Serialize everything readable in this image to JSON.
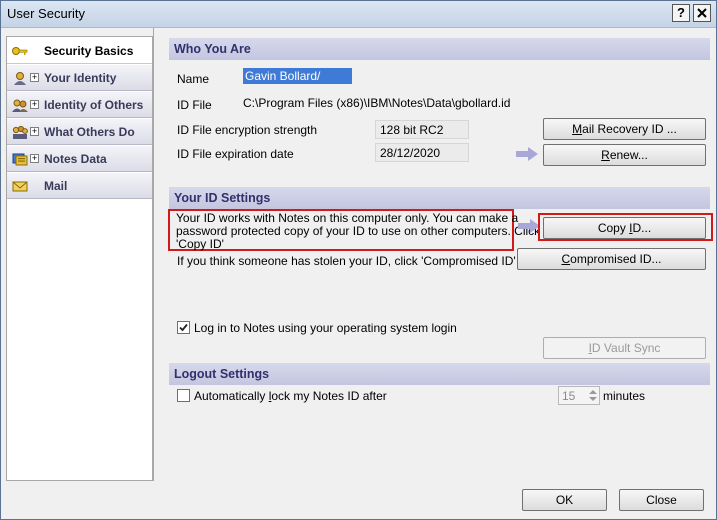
{
  "window": {
    "title": "User Security",
    "help_glyph": "?",
    "close_glyph": "X"
  },
  "sidebar": {
    "items": [
      {
        "label": "Security Basics",
        "icon": "key-icon"
      },
      {
        "label": "Your Identity",
        "icon": "person-icon"
      },
      {
        "label": "Identity of Others",
        "icon": "people-icon"
      },
      {
        "label": "What Others Do",
        "icon": "group-icon"
      },
      {
        "label": "Notes Data",
        "icon": "database-icon"
      },
      {
        "label": "Mail",
        "icon": "envelope-icon"
      }
    ],
    "expander": "+"
  },
  "who": {
    "heading": "Who You Are",
    "name_label": "Name",
    "name_value": "Gavin Bollard/",
    "idfile_label": "ID File",
    "idfile_value": "C:\\Program Files (x86)\\IBM\\Notes\\Data\\gbollard.id",
    "enc_label": "ID File encryption strength",
    "enc_value": "128 bit RC2",
    "exp_label": "ID File expiration date",
    "exp_value": "28/12/2020",
    "mail_recovery_pre": "M",
    "mail_recovery_post": "ail Recovery ID ...",
    "renew_pre": "R",
    "renew_post": "enew..."
  },
  "settings": {
    "heading": "Your ID Settings",
    "copy_text_1": "Your ID works with Notes on this computer only.  You can make a",
    "copy_text_2": "password protected copy of your ID to use on other computers.  Click",
    "copy_text_3": "'Copy ID'",
    "copy_pre": "Copy ",
    "copy_ul": "I",
    "copy_post": "D...",
    "stolen_text": "If you think someone has stolen your ID, click 'Compromised ID'",
    "compromised_pre": "C",
    "compromised_post": "ompromised ID...",
    "os_login_label": "Log in to Notes using your operating system login",
    "os_login_checked": true,
    "vault_pre": "I",
    "vault_post": "D Vault Sync"
  },
  "logout": {
    "heading": "Logout Settings",
    "lock_label_pre": "Automatically ",
    "lock_label_ul": "l",
    "lock_label_post": "ock my Notes ID after",
    "lock_checked": false,
    "minutes_value": "15",
    "minutes_label": "minutes"
  },
  "footer": {
    "ok_label": "OK",
    "close_label": "Close"
  },
  "colors": {
    "section_header": "#c4c6e0",
    "highlight": "#d21a1a",
    "arrow": "#a8a8d8",
    "selection": "#3f7bd6"
  }
}
